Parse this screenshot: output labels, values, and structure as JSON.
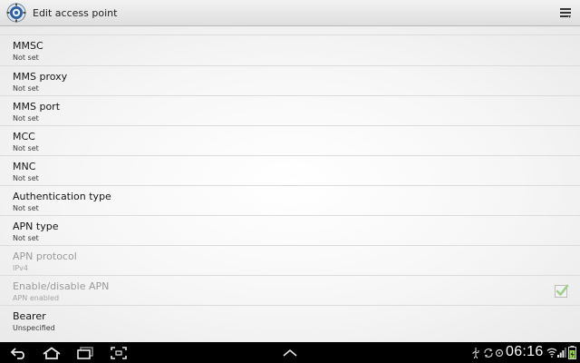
{
  "header": {
    "title": "Edit access point"
  },
  "settings": [
    {
      "title": "MMSC",
      "summary": "Not set",
      "enabled": true
    },
    {
      "title": "MMS proxy",
      "summary": "Not set",
      "enabled": true
    },
    {
      "title": "MMS port",
      "summary": "Not set",
      "enabled": true
    },
    {
      "title": "MCC",
      "summary": "Not set",
      "enabled": true
    },
    {
      "title": "MNC",
      "summary": "Not set",
      "enabled": true
    },
    {
      "title": "Authentication type",
      "summary": "Not set",
      "enabled": true
    },
    {
      "title": "APN type",
      "summary": "Not set",
      "enabled": true
    },
    {
      "title": "APN protocol",
      "summary": "IPv4",
      "enabled": false
    },
    {
      "title": "Enable/disable APN",
      "summary": "APN enabled",
      "enabled": false,
      "checked": true
    },
    {
      "title": "Bearer",
      "summary": "Unspecified",
      "enabled": true
    }
  ],
  "status_bar": {
    "time": "06:16"
  },
  "colors": {
    "navbar": "#000000",
    "check": "#9ccf8a"
  }
}
